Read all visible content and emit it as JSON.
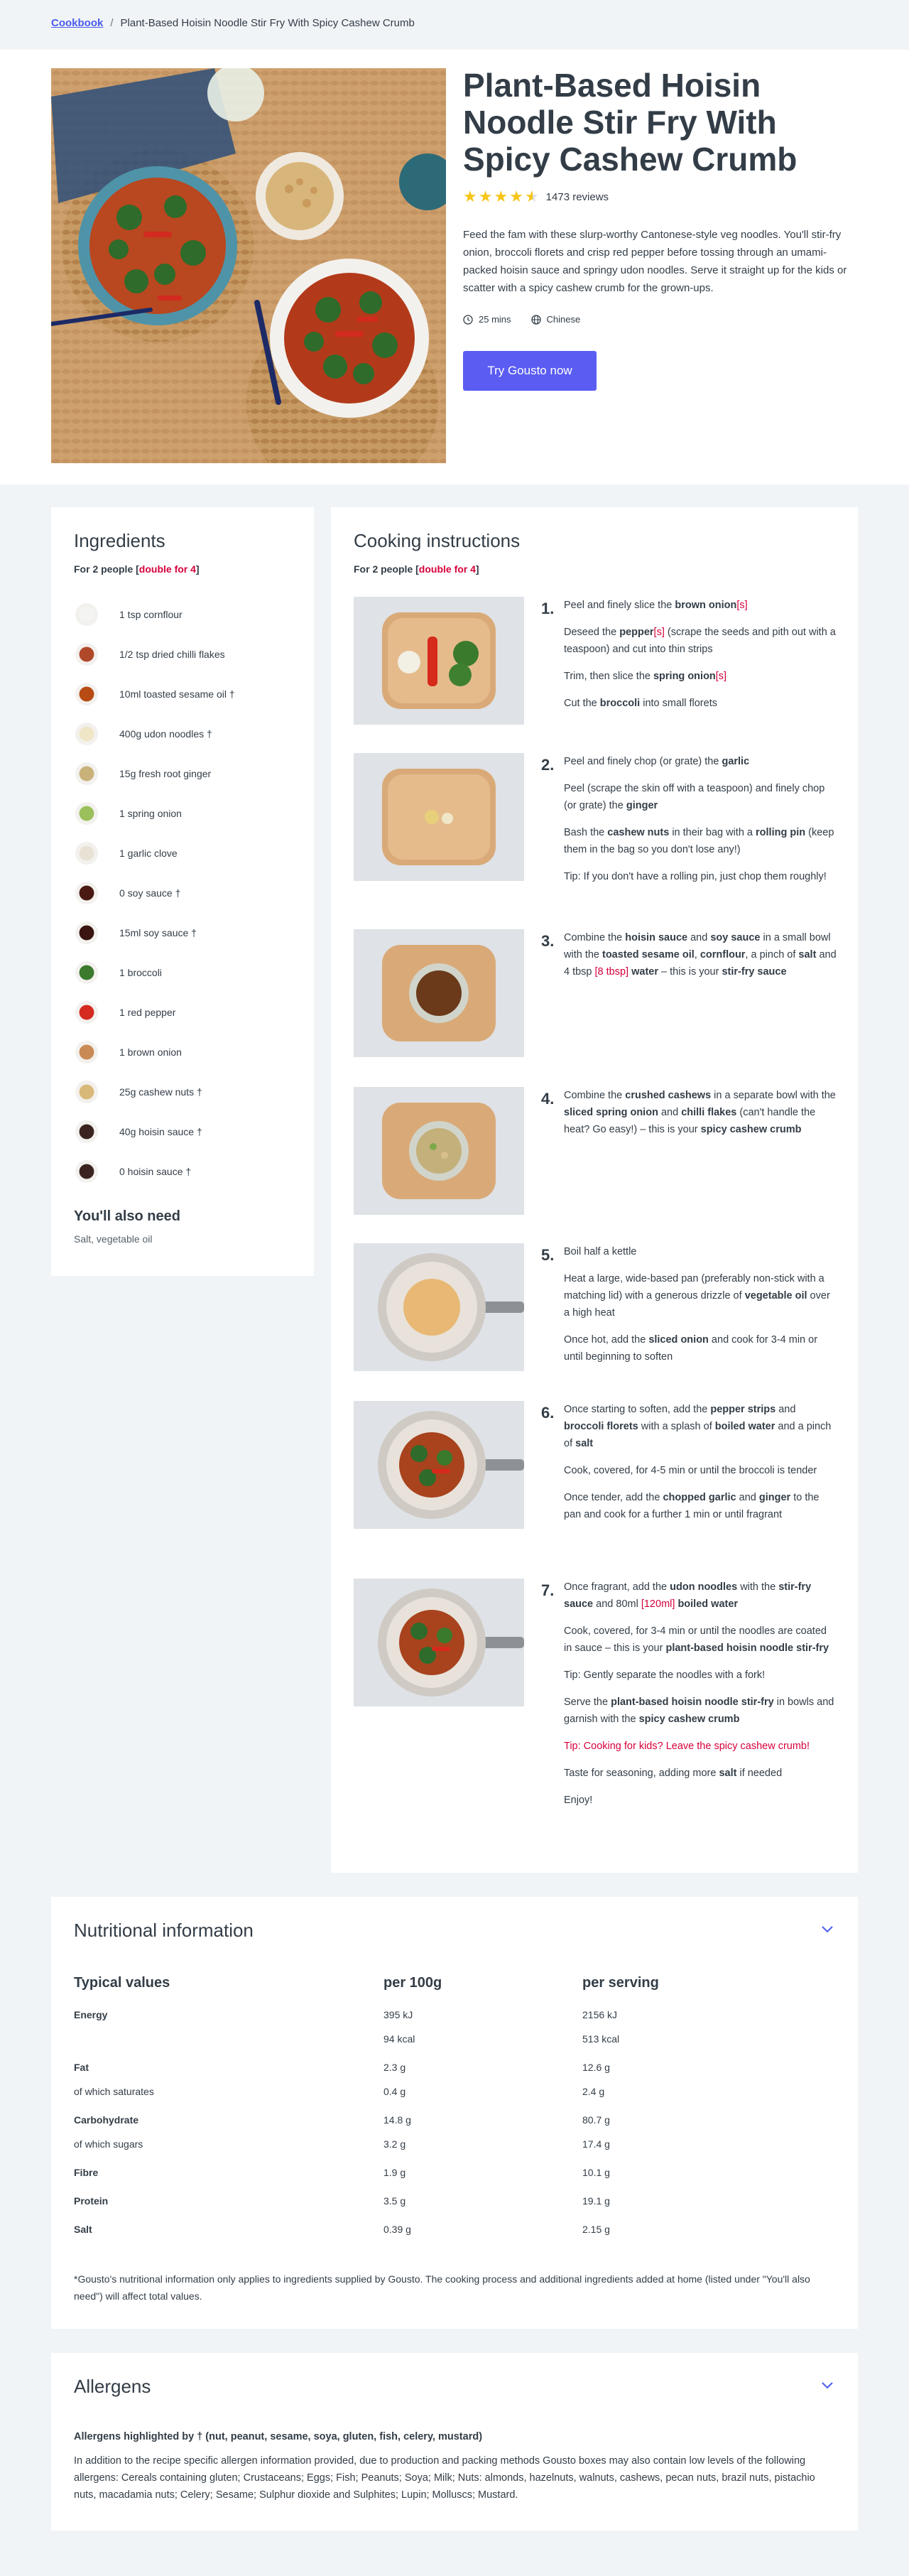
{
  "breadcrumb": {
    "root": "Cookbook",
    "sep": "/",
    "current": "Plant-Based Hoisin Noodle Stir Fry With Spicy Cashew Crumb"
  },
  "hero": {
    "title": "Plant-Based Hoisin Noodle Stir Fry With Spicy Cashew Crumb",
    "rating": 4.5,
    "reviews": "1473 reviews",
    "description": "Feed the fam with these slurp-worthy Cantonese-style veg noodles. You'll stir-fry onion, broccoli florets and crisp red pepper before tossing through an umami-packed hoisin sauce and springy udon noodles. Serve it straight up for the kids or scatter with a spicy cashew crumb for the grown-ups.",
    "time": "25 mins",
    "cuisine": "Chinese",
    "cta": "Try Gousto now"
  },
  "ingredients": {
    "title": "Ingredients",
    "for_prefix": "For 2 people [",
    "for_link": "double for 4",
    "for_suffix": "]",
    "items": [
      {
        "label": "1 tsp cornflour",
        "color": "#f4f4f2"
      },
      {
        "label": "1/2 tsp dried chilli flakes",
        "color": "#b0492a"
      },
      {
        "label": "10ml toasted sesame oil †",
        "color": "#b84a14"
      },
      {
        "label": "400g udon noodles †",
        "color": "#efe6c8"
      },
      {
        "label": "15g fresh root ginger",
        "color": "#c9b27a"
      },
      {
        "label": "1 spring onion",
        "color": "#9bbf5a"
      },
      {
        "label": "1 garlic clove",
        "color": "#e8e2d5"
      },
      {
        "label": "0 soy sauce †",
        "color": "#4a1a12"
      },
      {
        "label": "15ml soy sauce †",
        "color": "#3a1410"
      },
      {
        "label": "1 broccoli",
        "color": "#3c7a2e"
      },
      {
        "label": "1 red pepper",
        "color": "#d42a20"
      },
      {
        "label": "1 brown onion",
        "color": "#c98a55"
      },
      {
        "label": "25g cashew nuts †",
        "color": "#d9b97a"
      },
      {
        "label": "40g hoisin sauce †",
        "color": "#3b2420"
      },
      {
        "label": "0 hoisin sauce †",
        "color": "#3b2420"
      }
    ],
    "also_need_title": "You'll also need",
    "also_need": "Salt, vegetable oil"
  },
  "cooking": {
    "title": "Cooking instructions",
    "for_prefix": "For 2 people [",
    "for_link": "double for 4",
    "for_suffix": "]",
    "steps": [
      {
        "num": "1.",
        "paras": [
          "Peel and finely slice the <b>brown onion</b><span class='red'>[s]</span>",
          "Deseed the <b>pepper</b><span class='red'>[s]</span> (scrape the seeds and pith out with a teaspoon) and cut into thin strips",
          "Trim, then slice the <b>spring onion</b><span class='red'>[s]</span>",
          "Cut the <b>broccoli</b> into small florets"
        ]
      },
      {
        "num": "2.",
        "paras": [
          "Peel and finely chop (or grate) the <b>garlic</b>",
          "Peel (scrape the skin off with a teaspoon) and finely chop (or grate) the <b>ginger</b>",
          "Bash the <b>cashew nuts</b> in their bag with a <b>rolling pin</b> (keep them in the bag so you don't lose any!)",
          "Tip: If you don't have a rolling pin, just chop them roughly!"
        ]
      },
      {
        "num": "3.",
        "paras": [
          "Combine the <b>hoisin sauce</b> and <b>soy sauce</b> in a small bowl with the <b>toasted sesame oil</b>, <b>cornflour</b>, a pinch of <b>salt</b> and 4 tbsp <span class='red'>[8 tbsp]</span> <b>water</b> – this is your <b>stir-fry sauce</b>"
        ]
      },
      {
        "num": "4.",
        "paras": [
          "Combine the <b>crushed cashews</b> in a separate bowl with the <b>sliced spring onion</b> and <b>chilli flakes</b> (can't handle the heat? Go easy!) – this is your <b>spicy cashew crumb</b>"
        ]
      },
      {
        "num": "5.",
        "paras": [
          "Boil half a kettle",
          "Heat a large, wide-based pan (preferably non-stick with a matching lid) with a generous drizzle of <b>vegetable oil</b> over a high heat",
          "Once hot, add the <b>sliced onion</b> and cook for 3-4 min or until beginning to soften"
        ]
      },
      {
        "num": "6.",
        "paras": [
          "Once starting to soften, add the <b>pepper strips</b> and <b>broccoli florets</b> with a splash of <b>boiled water</b> and a pinch of <b>salt</b>",
          "Cook, covered, for 4-5 min or until the broccoli is tender",
          "Once tender, add the <b>chopped garlic</b> and <b>ginger</b> to the pan and cook for a further 1 min or until fragrant"
        ]
      },
      {
        "num": "7.",
        "paras": [
          "Once fragrant, add the <b>udon noodles</b> with the <b>stir-fry sauce</b> and 80ml <span class='red'>[120ml]</span> <b>boiled water</b>",
          "Cook, covered, for 3-4 min or until the noodles are coated in sauce – this is your <b>plant-based hoisin noodle stir-fry</b>",
          "Tip: Gently separate the noodles with a fork!",
          "Serve the <b>plant-based hoisin noodle stir-fry</b> in bowls and garnish with the <b>spicy cashew crumb</b>",
          "<span class='red'>Tip: Cooking for kids? Leave the spicy cashew crumb!</span>",
          "Taste for seasoning, adding more <b>salt</b> if needed",
          "Enjoy!"
        ]
      }
    ]
  },
  "nutrition": {
    "title": "Nutritional information",
    "headers": [
      "Typical values",
      "per 100g",
      "per serving"
    ],
    "rows": [
      {
        "label": "Energy",
        "bold": true,
        "p100": "395 kJ",
        "serving": "2156 kJ"
      },
      {
        "label": "",
        "bold": false,
        "p100": "94 kcal",
        "serving": "513 kcal"
      },
      {
        "label": "Fat",
        "bold": true,
        "p100": "2.3 g",
        "serving": "12.6 g"
      },
      {
        "label": "of which saturates",
        "bold": false,
        "p100": "0.4 g",
        "serving": "2.4 g"
      },
      {
        "label": "Carbohydrate",
        "bold": true,
        "p100": "14.8 g",
        "serving": "80.7 g"
      },
      {
        "label": "of which sugars",
        "bold": false,
        "p100": "3.2 g",
        "serving": "17.4 g"
      },
      {
        "label": "Fibre",
        "bold": true,
        "p100": "1.9 g",
        "serving": "10.1 g"
      },
      {
        "label": "Protein",
        "bold": true,
        "p100": "3.5 g",
        "serving": "19.1 g"
      },
      {
        "label": "Salt",
        "bold": true,
        "p100": "0.39 g",
        "serving": "2.15 g"
      }
    ],
    "note": "*Gousto's nutritional information only applies to ingredients supplied by Gousto. The cooking process and additional ingredients added at home (listed under \"You'll also need\") will affect total values."
  },
  "allergens": {
    "title": "Allergens",
    "highlight": "Allergens highlighted by † (nut, peanut, sesame, soya, gluten, fish, celery, mustard)",
    "text": "In addition to the recipe specific allergen information provided, due to production and packing methods Gousto boxes may also contain low levels of the following allergens: Cereals containing gluten; Crustaceans; Eggs; Fish; Peanuts; Soya; Milk; Nuts: almonds, hazelnuts, walnuts, cashews, pecan nuts, brazil nuts, pistachio nuts, macadamia nuts; Celery; Sesame; Sulphur dioxide and Sulphites; Lupin; Molluscs; Mustard."
  },
  "colors": {
    "accent": "#5a5cf2",
    "link": "#4a5cf0",
    "highlight": "#d6003b",
    "star": "#f5c518"
  }
}
